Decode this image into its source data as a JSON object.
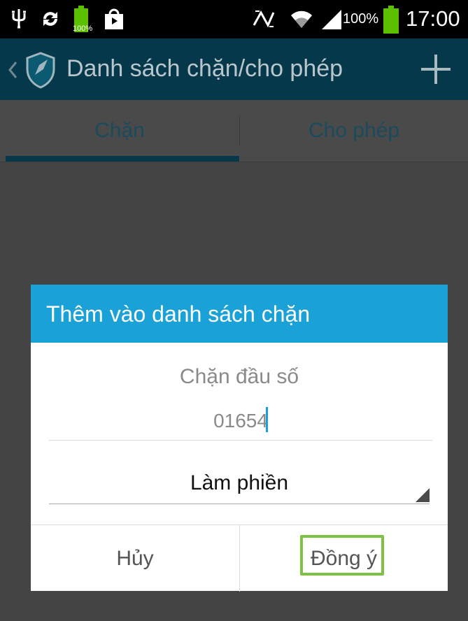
{
  "status_bar": {
    "battery_small_label": "100%",
    "battery_percent": "100%",
    "time": "17:00",
    "icons": [
      "usb-icon",
      "sync-icon",
      "battery-icon",
      "store-icon",
      "nfc-icon",
      "wifi-icon",
      "signal-icon",
      "battery-icon"
    ]
  },
  "action_bar": {
    "title": "Danh sách chặn/cho phép",
    "icons": [
      "back-chevron-icon",
      "shield-icon",
      "add-icon"
    ]
  },
  "tabs": [
    {
      "label": "Chặn",
      "selected": true
    },
    {
      "label": "Cho phép",
      "selected": false
    }
  ],
  "dialog": {
    "title": "Thêm vào danh sách chặn",
    "prefix_label": "Chặn đầu số",
    "number_value": "01654",
    "category_selected": "Làm phiền",
    "cancel_label": "Hủy",
    "confirm_label": "Đồng ý"
  },
  "colors": {
    "action_bar": "#05384a",
    "dialog_header": "#1aa1d7",
    "highlight": "#7dc242",
    "caret": "#1a9ee0"
  }
}
